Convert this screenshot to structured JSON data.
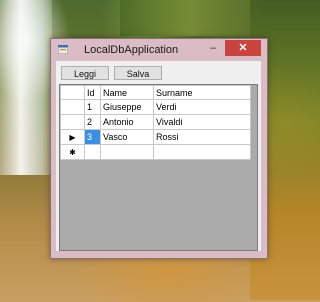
{
  "window": {
    "title": "LocalDbApplication",
    "minimize_glyph": "–",
    "maximize_glyph": "□",
    "close_glyph": "✕",
    "icon": "app-icon",
    "close_color": "#c9443c"
  },
  "toolbar": {
    "leggi_label": "Leggi",
    "salva_label": "Salva"
  },
  "grid": {
    "columns": [
      "Id",
      "Name",
      "Surname"
    ],
    "rows": [
      {
        "id": "1",
        "name": "Giuseppe",
        "surname": "Verdi"
      },
      {
        "id": "2",
        "name": "Antonio",
        "surname": "Vivaldi"
      },
      {
        "id": "3",
        "name": "Vasco",
        "surname": "Rossi"
      }
    ],
    "current_row_glyph": "▶",
    "new_row_glyph": "✱",
    "selection_color": "#3a8ee6"
  }
}
